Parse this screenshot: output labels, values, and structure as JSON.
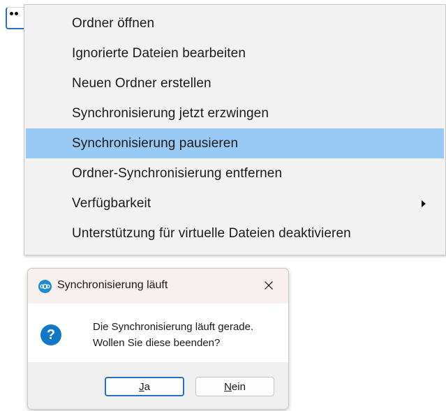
{
  "background_button": {
    "icon": "more-dots-icon"
  },
  "menu": {
    "items": [
      {
        "label": "Ordner öffnen"
      },
      {
        "label": "Ignorierte Dateien bearbeiten"
      },
      {
        "label": "Neuen Ordner erstellen"
      },
      {
        "label": "Synchronisierung jetzt erzwingen"
      },
      {
        "label": "Synchronisierung pausieren",
        "highlighted": true
      },
      {
        "label": "Ordner-Synchronisierung entfernen"
      },
      {
        "label": "Verfügbarkeit",
        "has_submenu": true
      },
      {
        "label": "Unterstützung für virtuelle Dateien deaktivieren"
      }
    ],
    "highlight_color": "#99c9f5"
  },
  "dialog": {
    "title": "Synchronisierung läuft",
    "app_icon": "nextcloud-icon",
    "message_line1": "Die Synchronisierung läuft gerade.",
    "message_line2": "Wollen Sie diese beenden?",
    "icon": "question-icon",
    "buttons": {
      "yes": {
        "mnemonic": "J",
        "rest": "a"
      },
      "no": {
        "mnemonic": "N",
        "rest": "ein"
      }
    },
    "accent_color": "#1a8bd6"
  }
}
